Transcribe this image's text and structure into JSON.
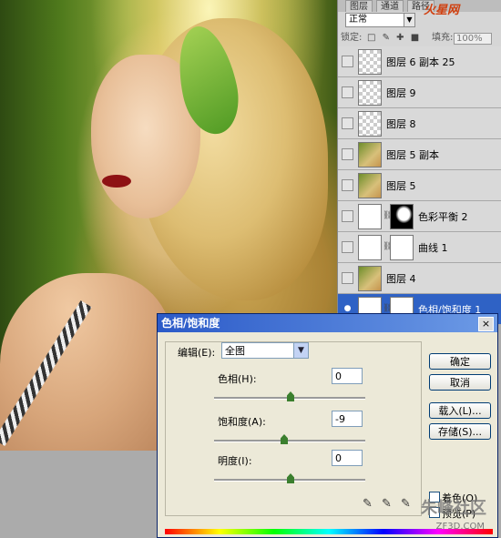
{
  "photo": {
    "alt": ""
  },
  "layers_panel": {
    "tabs": [
      "图层",
      "通道",
      "路径"
    ],
    "site_logo": "火星网",
    "blend_mode": "正常",
    "lock_label": "锁定:",
    "fill_label": "填充:",
    "fill_value": "100%",
    "layers": [
      {
        "name": "图层 6 副本 25",
        "thumb": "checker",
        "visible": false,
        "selected": false
      },
      {
        "name": "图层 9",
        "thumb": "checker",
        "visible": false,
        "selected": false
      },
      {
        "name": "图层 8",
        "thumb": "checker",
        "visible": false,
        "selected": false
      },
      {
        "name": "图层 5 副本",
        "thumb": "photo",
        "visible": false,
        "selected": false
      },
      {
        "name": "图层 5",
        "thumb": "photo",
        "visible": false,
        "selected": false
      },
      {
        "name": "色彩平衡 2",
        "thumb": "adjustment",
        "visible": false,
        "selected": false
      },
      {
        "name": "曲线 1",
        "thumb": "adjustment",
        "visible": false,
        "selected": false
      },
      {
        "name": "图层 4",
        "thumb": "photo",
        "visible": false,
        "selected": false
      },
      {
        "name": "色相/饱和度 1",
        "thumb": "adjustment",
        "visible": true,
        "selected": true
      }
    ]
  },
  "dialog": {
    "title": "色相/饱和度",
    "close_label": "×",
    "edit_label": "编辑(E):",
    "edit_value": "全图",
    "hue_label": "色相(H):",
    "hue_value": "0",
    "saturation_label": "饱和度(A):",
    "saturation_value": "-9",
    "lightness_label": "明度(I):",
    "lightness_value": "0",
    "buttons": {
      "ok": "确定",
      "cancel": "取消",
      "load": "载入(L)...",
      "save": "存储(S)..."
    },
    "colorize_label": "着色(O)",
    "preview_label": "预览(P)",
    "watermark": "朱峰社区",
    "watermark_url": "ZF3D.COM",
    "accent_color": "#2b5ac8"
  }
}
